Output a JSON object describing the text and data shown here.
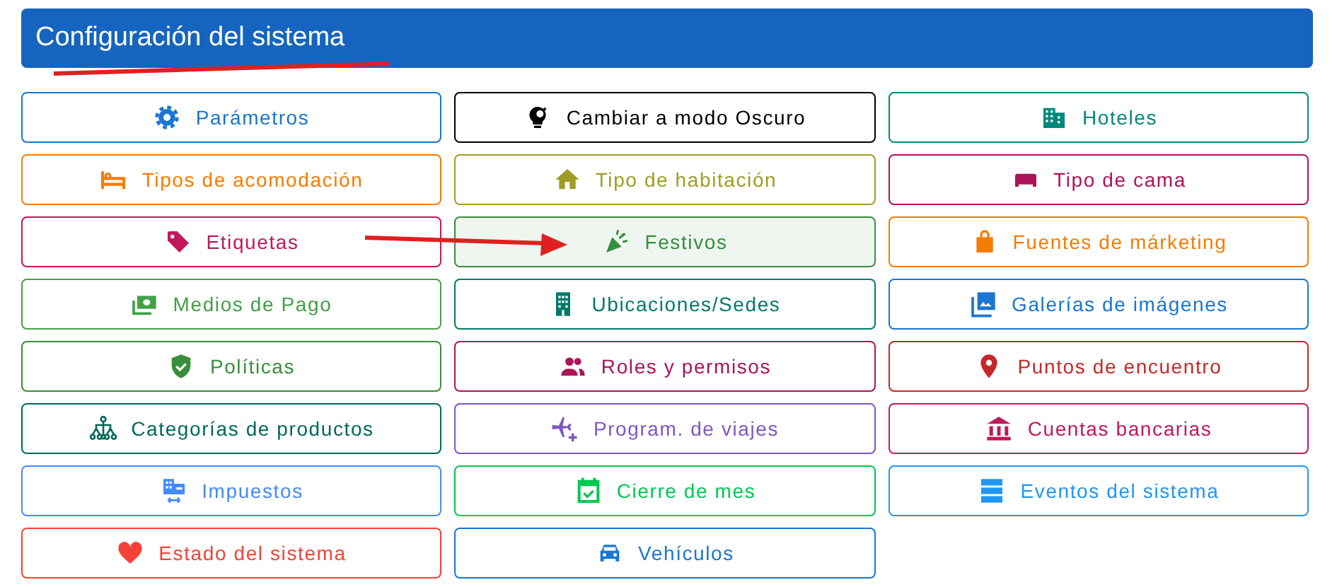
{
  "header": {
    "title": "Configuración del sistema"
  },
  "items": [
    {
      "label": "Parámetros",
      "color": "#1976d2",
      "selected": false
    },
    {
      "label": "Cambiar a modo Oscuro",
      "color": "#000000",
      "selected": false
    },
    {
      "label": "Hoteles",
      "color": "#00897b",
      "selected": false
    },
    {
      "label": "Tipos de acomodación",
      "color": "#f57c00",
      "selected": false
    },
    {
      "label": "Tipo de habitación",
      "color": "#9e9d24",
      "selected": false
    },
    {
      "label": "Tipo de cama",
      "color": "#ad1457",
      "selected": false
    },
    {
      "label": "Etiquetas",
      "color": "#c2185b",
      "selected": false
    },
    {
      "label": "Festivos",
      "color": "#388e3c",
      "selected": true
    },
    {
      "label": "Fuentes de márketing",
      "color": "#f57c00",
      "selected": false
    },
    {
      "label": "Medios de Pago",
      "color": "#43a047",
      "selected": false
    },
    {
      "label": "Ubicaciones/Sedes",
      "color": "#00796b",
      "selected": false
    },
    {
      "label": "Galerías de imágenes",
      "color": "#1976d2",
      "selected": false
    },
    {
      "label": "Políticas",
      "color": "#388e3c",
      "selected": false
    },
    {
      "label": "Roles y permisos",
      "color": "#ad1457",
      "selected": false
    },
    {
      "label": "Puntos de encuentro",
      "color": "#c62828",
      "selected": false
    },
    {
      "label": "Categorías de productos",
      "color": "#00695c",
      "selected": false
    },
    {
      "label": "Program. de viajes",
      "color": "#7e57c2",
      "selected": false
    },
    {
      "label": "Cuentas bancarias",
      "color": "#c2185b",
      "selected": false
    },
    {
      "label": "Impuestos",
      "color": "#448aff",
      "selected": false
    },
    {
      "label": "Cierre de mes",
      "color": "#00c853",
      "selected": false
    },
    {
      "label": "Eventos del sistema",
      "color": "#2196f3",
      "selected": false
    },
    {
      "label": "Estado del sistema",
      "color": "#f44336",
      "selected": false
    },
    {
      "label": "Vehículos",
      "color": "#1976d2",
      "selected": false
    }
  ]
}
